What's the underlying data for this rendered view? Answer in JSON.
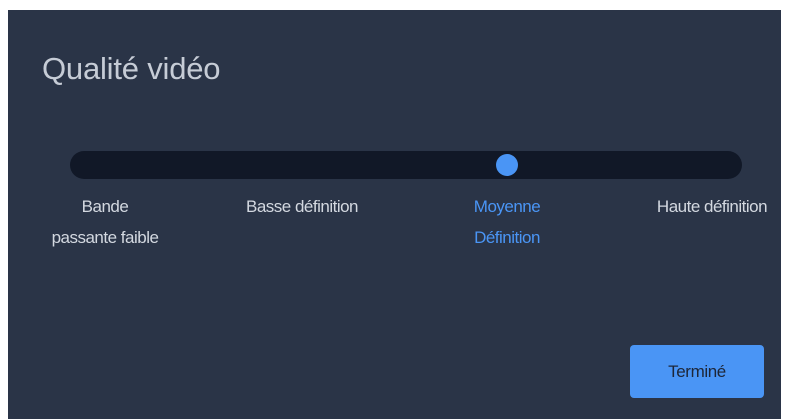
{
  "dialog": {
    "title": "Qualité vidéo",
    "colors": {
      "background": "#2a3447",
      "track": "#111827",
      "accent": "#4a95f5",
      "text": "#d3d8e0",
      "title_text": "#c6ccd6"
    }
  },
  "quality_slider": {
    "levels": [
      "Bande passante faible",
      "Basse définition",
      "Moyenne Définition",
      "Haute définition"
    ],
    "selected_index": 2,
    "value_fraction": 0.65
  },
  "done_button": {
    "label": "Terminé"
  }
}
